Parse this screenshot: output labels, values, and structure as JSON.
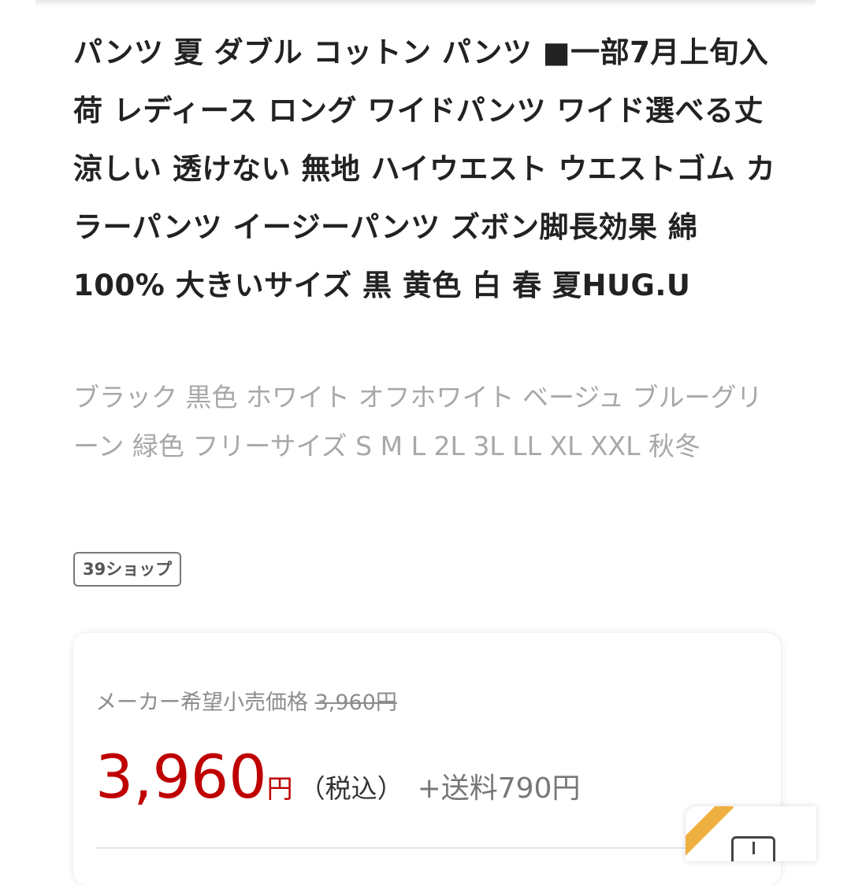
{
  "product": {
    "title": "パンツ 夏 ダブル コットン パンツ ■一部7月上旬入荷 レディース ロング ワイドパンツ ワイド選べる丈 涼しい 透けない 無地 ハイウエスト ウエストゴム カラーパンツ イージーパンツ ズボン脚長効果 綿100% 大きいサイズ 黒 黄色 白 春 夏HUG.U",
    "subtitle": "ブラック 黒色 ホワイト オフホワイト ベージュ ブルーグリーン 緑色 フリーサイズ S M L 2L 3L LL XL XXL 秋冬"
  },
  "badge": {
    "label": "39ショップ"
  },
  "price": {
    "list_label": "メーカー希望小売価格",
    "list_value": "3,960円",
    "amount": "3,960",
    "yen": "円",
    "tax_note": "（税込）",
    "shipping": "+送料790円"
  },
  "colors": {
    "price_red": "#bf0000",
    "widget_orange": "#f0b040",
    "title_text": "#222222",
    "subtitle_text": "#a8a8a8"
  },
  "icons": {
    "widget": "bag-icon"
  }
}
